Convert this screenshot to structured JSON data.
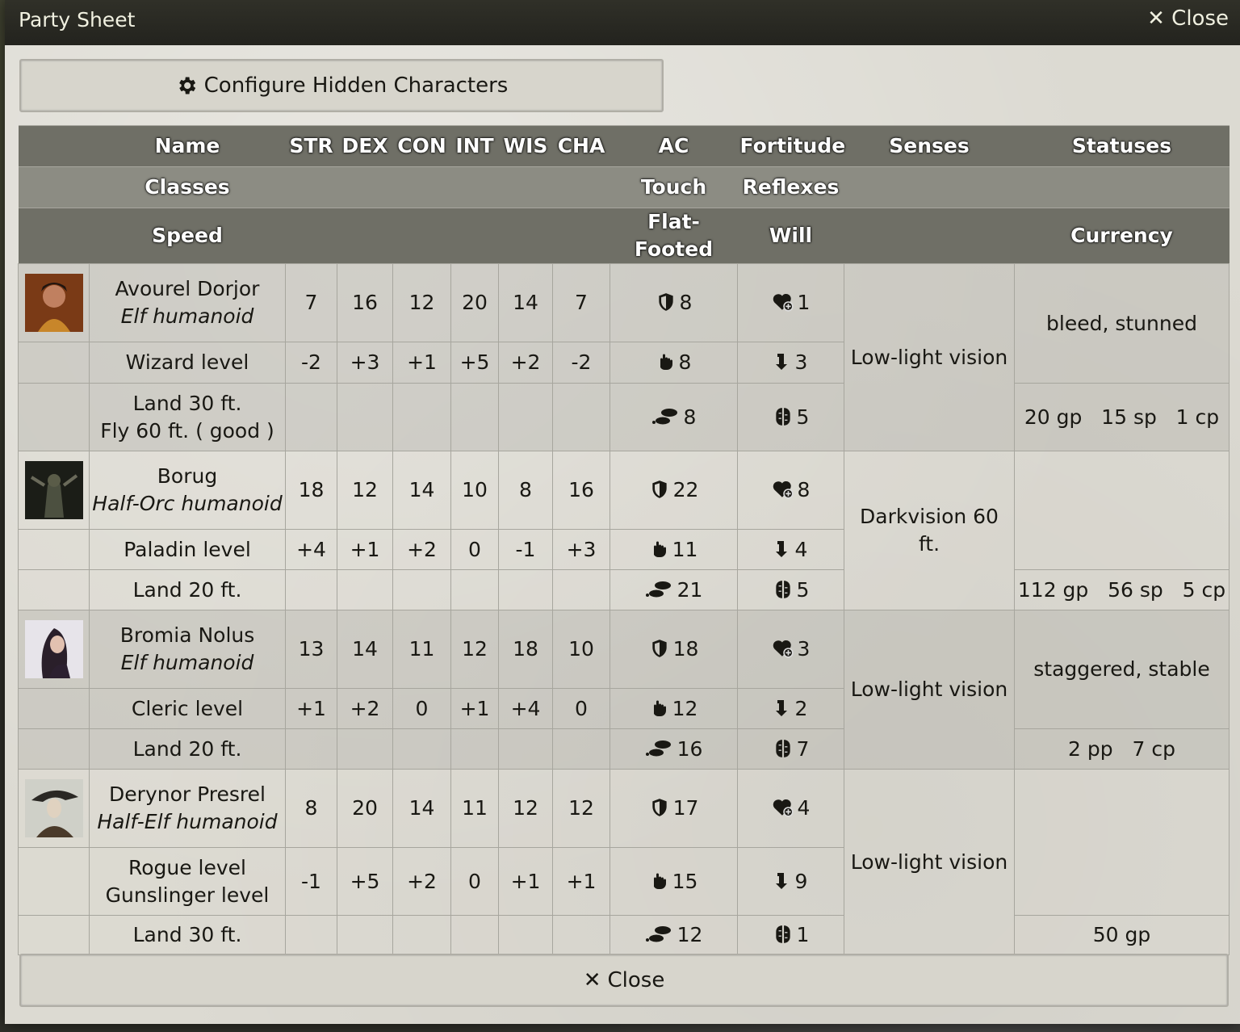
{
  "window": {
    "title": "Party Sheet",
    "close_label": "Close"
  },
  "configure_label": "Configure Hidden Characters",
  "footer_close_label": "Close",
  "headers": {
    "row1": {
      "name": "Name",
      "str": "STR",
      "dex": "DEX",
      "con": "CON",
      "int": "INT",
      "wis": "WIS",
      "cha": "CHA",
      "ac": "AC",
      "fort": "Fortitude",
      "senses": "Senses",
      "statuses": "Statuses"
    },
    "row2": {
      "classes": "Classes",
      "touch": "Touch",
      "reflex": "Reflexes"
    },
    "row3": {
      "speed": "Speed",
      "flat": "Flat-Footed",
      "will": "Will",
      "currency": "Currency"
    }
  },
  "characters": [
    {
      "name": "Avourel Dorjor",
      "race": "Elf humanoid",
      "classes": [
        "Wizard level"
      ],
      "speed": [
        "Land 30 ft.",
        "Fly 60 ft. ( good )"
      ],
      "abilities": [
        "7",
        "16",
        "12",
        "20",
        "14",
        "7"
      ],
      "mods": [
        "-2",
        "+3",
        "+1",
        "+5",
        "+2",
        "-2"
      ],
      "ac": "8",
      "touch": "8",
      "flat": "8",
      "fort": "1",
      "ref": "3",
      "will": "5",
      "senses": "Low-light vision",
      "statuses": "bleed, stunned",
      "currency": "20 gp   15 sp   1 cp"
    },
    {
      "name": "Borug",
      "race": "Half-Orc humanoid",
      "classes": [
        "Paladin level"
      ],
      "speed": [
        "Land 20 ft."
      ],
      "abilities": [
        "18",
        "12",
        "14",
        "10",
        "8",
        "16"
      ],
      "mods": [
        "+4",
        "+1",
        "+2",
        "0",
        "-1",
        "+3"
      ],
      "ac": "22",
      "touch": "11",
      "flat": "21",
      "fort": "8",
      "ref": "4",
      "will": "5",
      "senses": "Darkvision 60 ft.",
      "statuses": "",
      "currency": "112 gp   56 sp   5 cp"
    },
    {
      "name": "Bromia Nolus",
      "race": "Elf humanoid",
      "classes": [
        "Cleric level"
      ],
      "speed": [
        "Land 20 ft."
      ],
      "abilities": [
        "13",
        "14",
        "11",
        "12",
        "18",
        "10"
      ],
      "mods": [
        "+1",
        "+2",
        "0",
        "+1",
        "+4",
        "0"
      ],
      "ac": "18",
      "touch": "12",
      "flat": "16",
      "fort": "3",
      "ref": "2",
      "will": "7",
      "senses": "Low-light vision",
      "statuses": "staggered, stable",
      "currency": "2 pp   7 cp"
    },
    {
      "name": "Derynor Presrel",
      "race": "Half-Elf humanoid",
      "classes": [
        "Rogue level",
        "Gunslinger level"
      ],
      "speed": [
        "Land 30 ft."
      ],
      "abilities": [
        "8",
        "20",
        "14",
        "11",
        "12",
        "12"
      ],
      "mods": [
        "-1",
        "+5",
        "+2",
        "0",
        "+1",
        "+1"
      ],
      "ac": "17",
      "touch": "15",
      "flat": "12",
      "fort": "4",
      "ref": "9",
      "will": "1",
      "senses": "Low-light vision",
      "statuses": "",
      "currency": "50 gp"
    }
  ],
  "icons": {
    "settings": "gear-icon",
    "close": "close-icon",
    "ac": "shield-icon",
    "touch": "hand-icon",
    "flat": "footprints-icon",
    "fort": "heart-plus-icon",
    "ref": "arrow-down-icon",
    "will": "brain-icon"
  }
}
